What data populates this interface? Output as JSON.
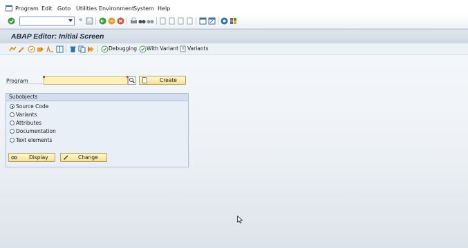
{
  "menu": {
    "items": [
      "Program",
      "Edit",
      "Goto",
      "Utilities",
      "Environment",
      "System",
      "Help"
    ]
  },
  "standard_toolbar": {
    "command_field_value": "",
    "icons": [
      "enter-icon",
      "command-dropdown-icon",
      "back-double-arrow-icon",
      "save-icon",
      "back-icon",
      "exit-icon",
      "cancel-icon",
      "print-icon",
      "find-icon",
      "find-next-icon",
      "first-page-icon",
      "previous-page-icon",
      "next-page-icon",
      "last-page-icon",
      "create-session-icon",
      "shortcut-icon",
      "help-icon",
      "customize-layout-icon"
    ]
  },
  "title": "ABAP Editor: Initial Screen",
  "app_toolbar": {
    "debugging_label": "Debugging",
    "with_variant_label": "With Variant",
    "variants_label": "Variants"
  },
  "program": {
    "label": "Program",
    "value": "",
    "create_label": "Create"
  },
  "subobjects": {
    "title": "Subobjects",
    "options": [
      {
        "label": "Source Code",
        "selected": true
      },
      {
        "label": "Variants",
        "selected": false
      },
      {
        "label": "Attributes",
        "selected": false
      },
      {
        "label": "Documentation",
        "selected": false
      },
      {
        "label": "Text elements",
        "selected": false
      }
    ],
    "display_label": "Display",
    "change_label": "Change"
  },
  "colors": {
    "title_bar": "#cfd8e3",
    "required_field": "#fff1b8",
    "button": "#f5e29a",
    "group_box": "#e8eff7"
  }
}
